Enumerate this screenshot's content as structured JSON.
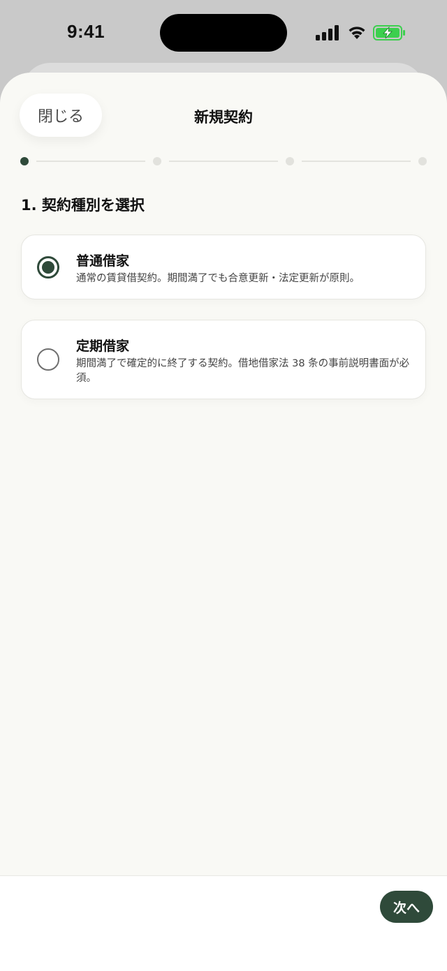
{
  "status_bar": {
    "time": "9:41",
    "icons": [
      "signal-icon",
      "wifi-icon",
      "battery-charging-icon"
    ],
    "battery_color": "#3ccf4e"
  },
  "sheet": {
    "close_label": "閉じる",
    "title": "新規契約"
  },
  "stepper": {
    "total_steps": 4,
    "current_step": 1
  },
  "section": {
    "title": "1. 契約種別を選択"
  },
  "options": [
    {
      "title": "普通借家",
      "description": "通常の賃貸借契約。期間満了でも合意更新・法定更新が原則。",
      "selected": true
    },
    {
      "title": "定期借家",
      "description": "期間満了で確定的に終了する契約。借地借家法 38 条の事前説明書面が必須。",
      "selected": false
    }
  ],
  "footer": {
    "next_label": "次へ"
  },
  "colors": {
    "accent": "#2f4a3a",
    "sheet_background": "#f9f9f5"
  }
}
